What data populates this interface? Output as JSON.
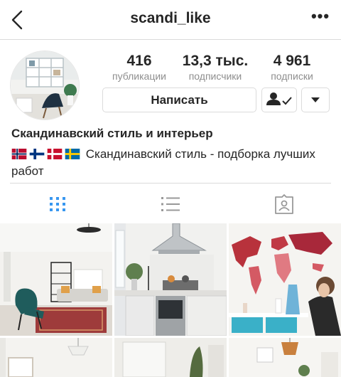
{
  "header": {
    "username": "scandi_like",
    "more_label": "•••"
  },
  "profile": {
    "stats": [
      {
        "value": "416",
        "label": "публикации"
      },
      {
        "value": "13,3 тыс.",
        "label": "подписчики"
      },
      {
        "value": "4 961",
        "label": "подписки"
      }
    ],
    "message_button": "Написать",
    "display_name": "Скандинавский стиль и интерьер",
    "bio_text": "Скандинавский стиль - подборка лучших работ",
    "bio_flags": [
      "norway-flag",
      "finland-flag",
      "denmark-flag",
      "sweden-flag"
    ]
  },
  "tabs": [
    {
      "name": "grid-view",
      "active": true
    },
    {
      "name": "list-view",
      "active": false
    },
    {
      "name": "tagged-photos",
      "active": false
    }
  ],
  "colors": {
    "accent": "#3897f0",
    "border": "#dbdbdb",
    "muted": "#8e8e8e"
  }
}
